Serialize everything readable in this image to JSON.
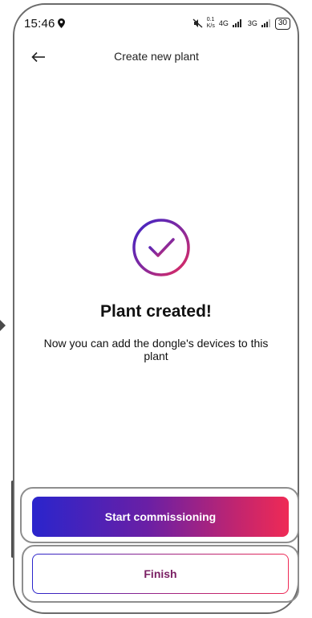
{
  "status_bar": {
    "time": "15:46",
    "net_speed_top": "0.1",
    "net_speed_bottom": "K/s",
    "signal1": "4G",
    "signal2": "3G",
    "battery": "30"
  },
  "header": {
    "title": "Create new plant"
  },
  "success": {
    "title": "Plant created!",
    "message": "Now you can add the dongle's devices to this plant"
  },
  "buttons": {
    "primary_label": "Start commissioning",
    "secondary_label": "Finish"
  },
  "colors": {
    "gradient_start": "#2a25cc",
    "gradient_end": "#ef2a55",
    "secondary_text": "#7a1f63"
  }
}
